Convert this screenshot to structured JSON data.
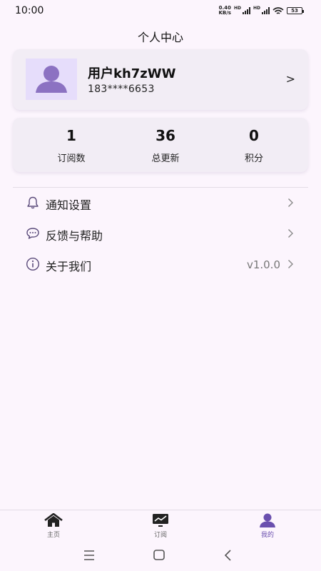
{
  "status_bar": {
    "time": "10:00",
    "net_speed_value": "0.40",
    "net_speed_unit": "KB/s",
    "hd_label": "HD",
    "battery": "53"
  },
  "header": {
    "title": "个人中心"
  },
  "profile": {
    "username": "用户kh7zWW",
    "phone": "183****6653",
    "arrow": ">"
  },
  "stats": [
    {
      "value": "1",
      "label": "订阅数"
    },
    {
      "value": "36",
      "label": "总更新"
    },
    {
      "value": "0",
      "label": "积分"
    }
  ],
  "menu": [
    {
      "label": "通知设置",
      "icon": "bell-icon",
      "extra": ""
    },
    {
      "label": "反馈与帮助",
      "icon": "chat-bubble-icon",
      "extra": ""
    },
    {
      "label": "关于我们",
      "icon": "info-icon",
      "extra": "v1.0.0"
    }
  ],
  "bottom_nav": [
    {
      "label": "主页",
      "icon": "home-icon",
      "active": false
    },
    {
      "label": "订阅",
      "icon": "trend-chart-icon",
      "active": false
    },
    {
      "label": "我的",
      "icon": "person-icon",
      "active": true
    }
  ],
  "system_nav": [
    "menu-lines-icon",
    "home-square-icon",
    "back-chevron-icon"
  ],
  "colors": {
    "background": "#FCF5FD",
    "card": "#F2EDF5",
    "accent": "#6A4FAE",
    "avatar_bg": "#E6DDFB",
    "avatar_figure": "#8C72C2"
  }
}
